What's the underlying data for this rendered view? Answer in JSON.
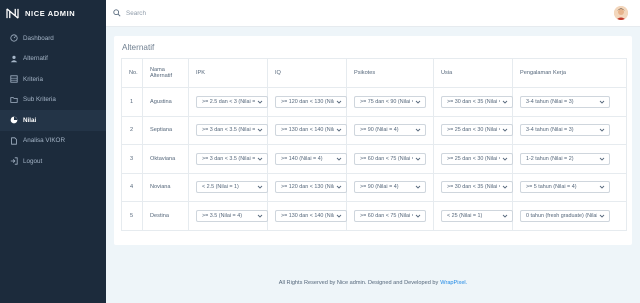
{
  "brand": {
    "name": "NICE ADMIN"
  },
  "sidebar": {
    "items": [
      {
        "label": "Dashboard",
        "icon": "dashboard-icon",
        "active": false
      },
      {
        "label": "Alternatif",
        "icon": "users-icon",
        "active": false
      },
      {
        "label": "Kriteria",
        "icon": "layers-icon",
        "active": false
      },
      {
        "label": "Sub Kriteria",
        "icon": "folder-icon",
        "active": false
      },
      {
        "label": "Nilai",
        "icon": "chart-icon",
        "active": true
      },
      {
        "label": "Analisa VIKOR",
        "icon": "file-icon",
        "active": false
      },
      {
        "label": "Logout",
        "icon": "logout-icon",
        "active": false
      }
    ]
  },
  "search": {
    "placeholder": "Search"
  },
  "card": {
    "title": "Alternatif"
  },
  "table": {
    "headers": [
      "No.",
      "Nama Alternatif",
      "IPK",
      "IQ",
      "Psikotes",
      "Usia",
      "Pengalaman Kerja"
    ],
    "rows": [
      {
        "no": "1",
        "name": "Agustina",
        "ipk": ">= 2.5 dan < 3 (Nilai = 2)",
        "iq": ">= 120 dan < 130 (Nilai = 2)",
        "psikotes": ">= 75 dan < 90 (Nilai = 3)",
        "usia": ">= 30 dan < 35 (Nilai = 3)",
        "pengalaman": "3-4 tahun (Nilai = 3)"
      },
      {
        "no": "2",
        "name": "Septiana",
        "ipk": ">= 3 dan < 3.5 (Nilai = 3)",
        "iq": ">= 130 dan < 140 (Nilai = 3)",
        "psikotes": ">= 90 (Nilai = 4)",
        "usia": ">= 25 dan < 30 (Nilai = 2)",
        "pengalaman": "3-4 tahun (Nilai = 3)"
      },
      {
        "no": "3",
        "name": "Oktaviana",
        "ipk": ">= 3 dan < 3.5 (Nilai = 3)",
        "iq": ">= 140 (Nilai = 4)",
        "psikotes": ">= 60 dan < 75 (Nilai = 2)",
        "usia": ">= 25 dan < 30 (Nilai = 2)",
        "pengalaman": "1-2 tahun (Nilai = 2)"
      },
      {
        "no": "4",
        "name": "Noviana",
        "ipk": "< 2.5 (Nilai = 1)",
        "iq": ">= 120 dan < 130 (Nilai = 2)",
        "psikotes": ">= 90 (Nilai = 4)",
        "usia": ">= 30 dan < 35 (Nilai = 3)",
        "pengalaman": ">= 5 tahun (Nilai = 4)"
      },
      {
        "no": "5",
        "name": "Destina",
        "ipk": ">= 3.5 (Nilai = 4)",
        "iq": ">= 130 dan < 140 (Nilai = 3)",
        "psikotes": ">= 60 dan < 75 (Nilai = 2)",
        "usia": "< 25 (Nilai = 1)",
        "pengalaman": "0 tahun (fresh graduate) (Nilai = 1)"
      }
    ]
  },
  "footer": {
    "text": "All Rights Reserved by Nice admin. Designed and Developed by",
    "link": "WrapPixel."
  },
  "colors": {
    "sidebar": "#1c2b3c",
    "accent": "#1e88e5",
    "background": "#eef5f9"
  }
}
